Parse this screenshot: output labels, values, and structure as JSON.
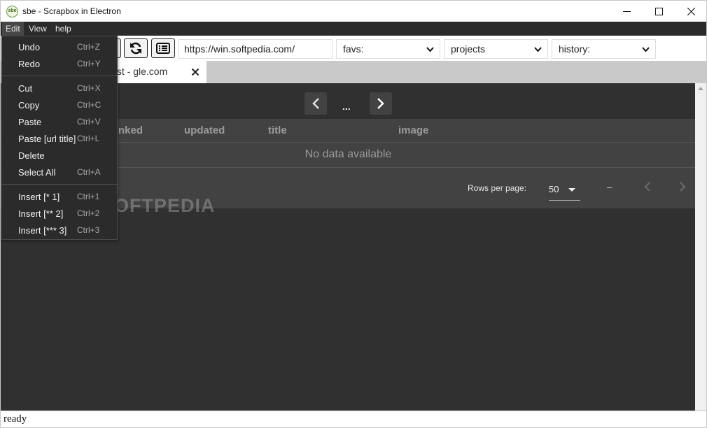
{
  "window": {
    "title": "sbe - Scrapbox in Electron",
    "icon_text": "sbe"
  },
  "menubar": {
    "edit": "Edit",
    "view": "View",
    "help": "help"
  },
  "edit_menu": {
    "items": [
      {
        "label": "Undo",
        "shortcut": "Ctrl+Z"
      },
      {
        "label": "Redo",
        "shortcut": "Ctrl+Y"
      },
      {
        "label": "Cut",
        "shortcut": "Ctrl+X"
      },
      {
        "label": "Copy",
        "shortcut": "Ctrl+C"
      },
      {
        "label": "Paste",
        "shortcut": "Ctrl+V"
      },
      {
        "label": "Paste [url title]",
        "shortcut": "Ctrl+L"
      },
      {
        "label": "Delete",
        "shortcut": ""
      },
      {
        "label": "Select All",
        "shortcut": "Ctrl+A"
      },
      {
        "label": "Insert [* 1]",
        "shortcut": "Ctrl+1"
      },
      {
        "label": "Insert [** 2]",
        "shortcut": "Ctrl+2"
      },
      {
        "label": "Insert [*** 3]",
        "shortcut": "Ctrl+3"
      }
    ]
  },
  "toolbar": {
    "url": "https://win.softpedia.com/",
    "favs": "favs:",
    "projects": "projects",
    "history": "history:"
  },
  "tab": {
    "label": "e list - gle.com"
  },
  "pager": {
    "dots": "..."
  },
  "table": {
    "headers": [
      "nked",
      "updated",
      "title",
      "image"
    ],
    "empty_text": "No data available",
    "rows_per_page_label": "Rows per page:",
    "rows_per_page": "50",
    "page_range": "–"
  },
  "status": {
    "text": "ready"
  },
  "watermark": "SOFTPEDIA",
  "colors": {
    "menu_bg": "#2b2b2b",
    "content_bg": "#303030",
    "table_bg": "#424242",
    "tabbar_bg": "#c9c9c9"
  }
}
